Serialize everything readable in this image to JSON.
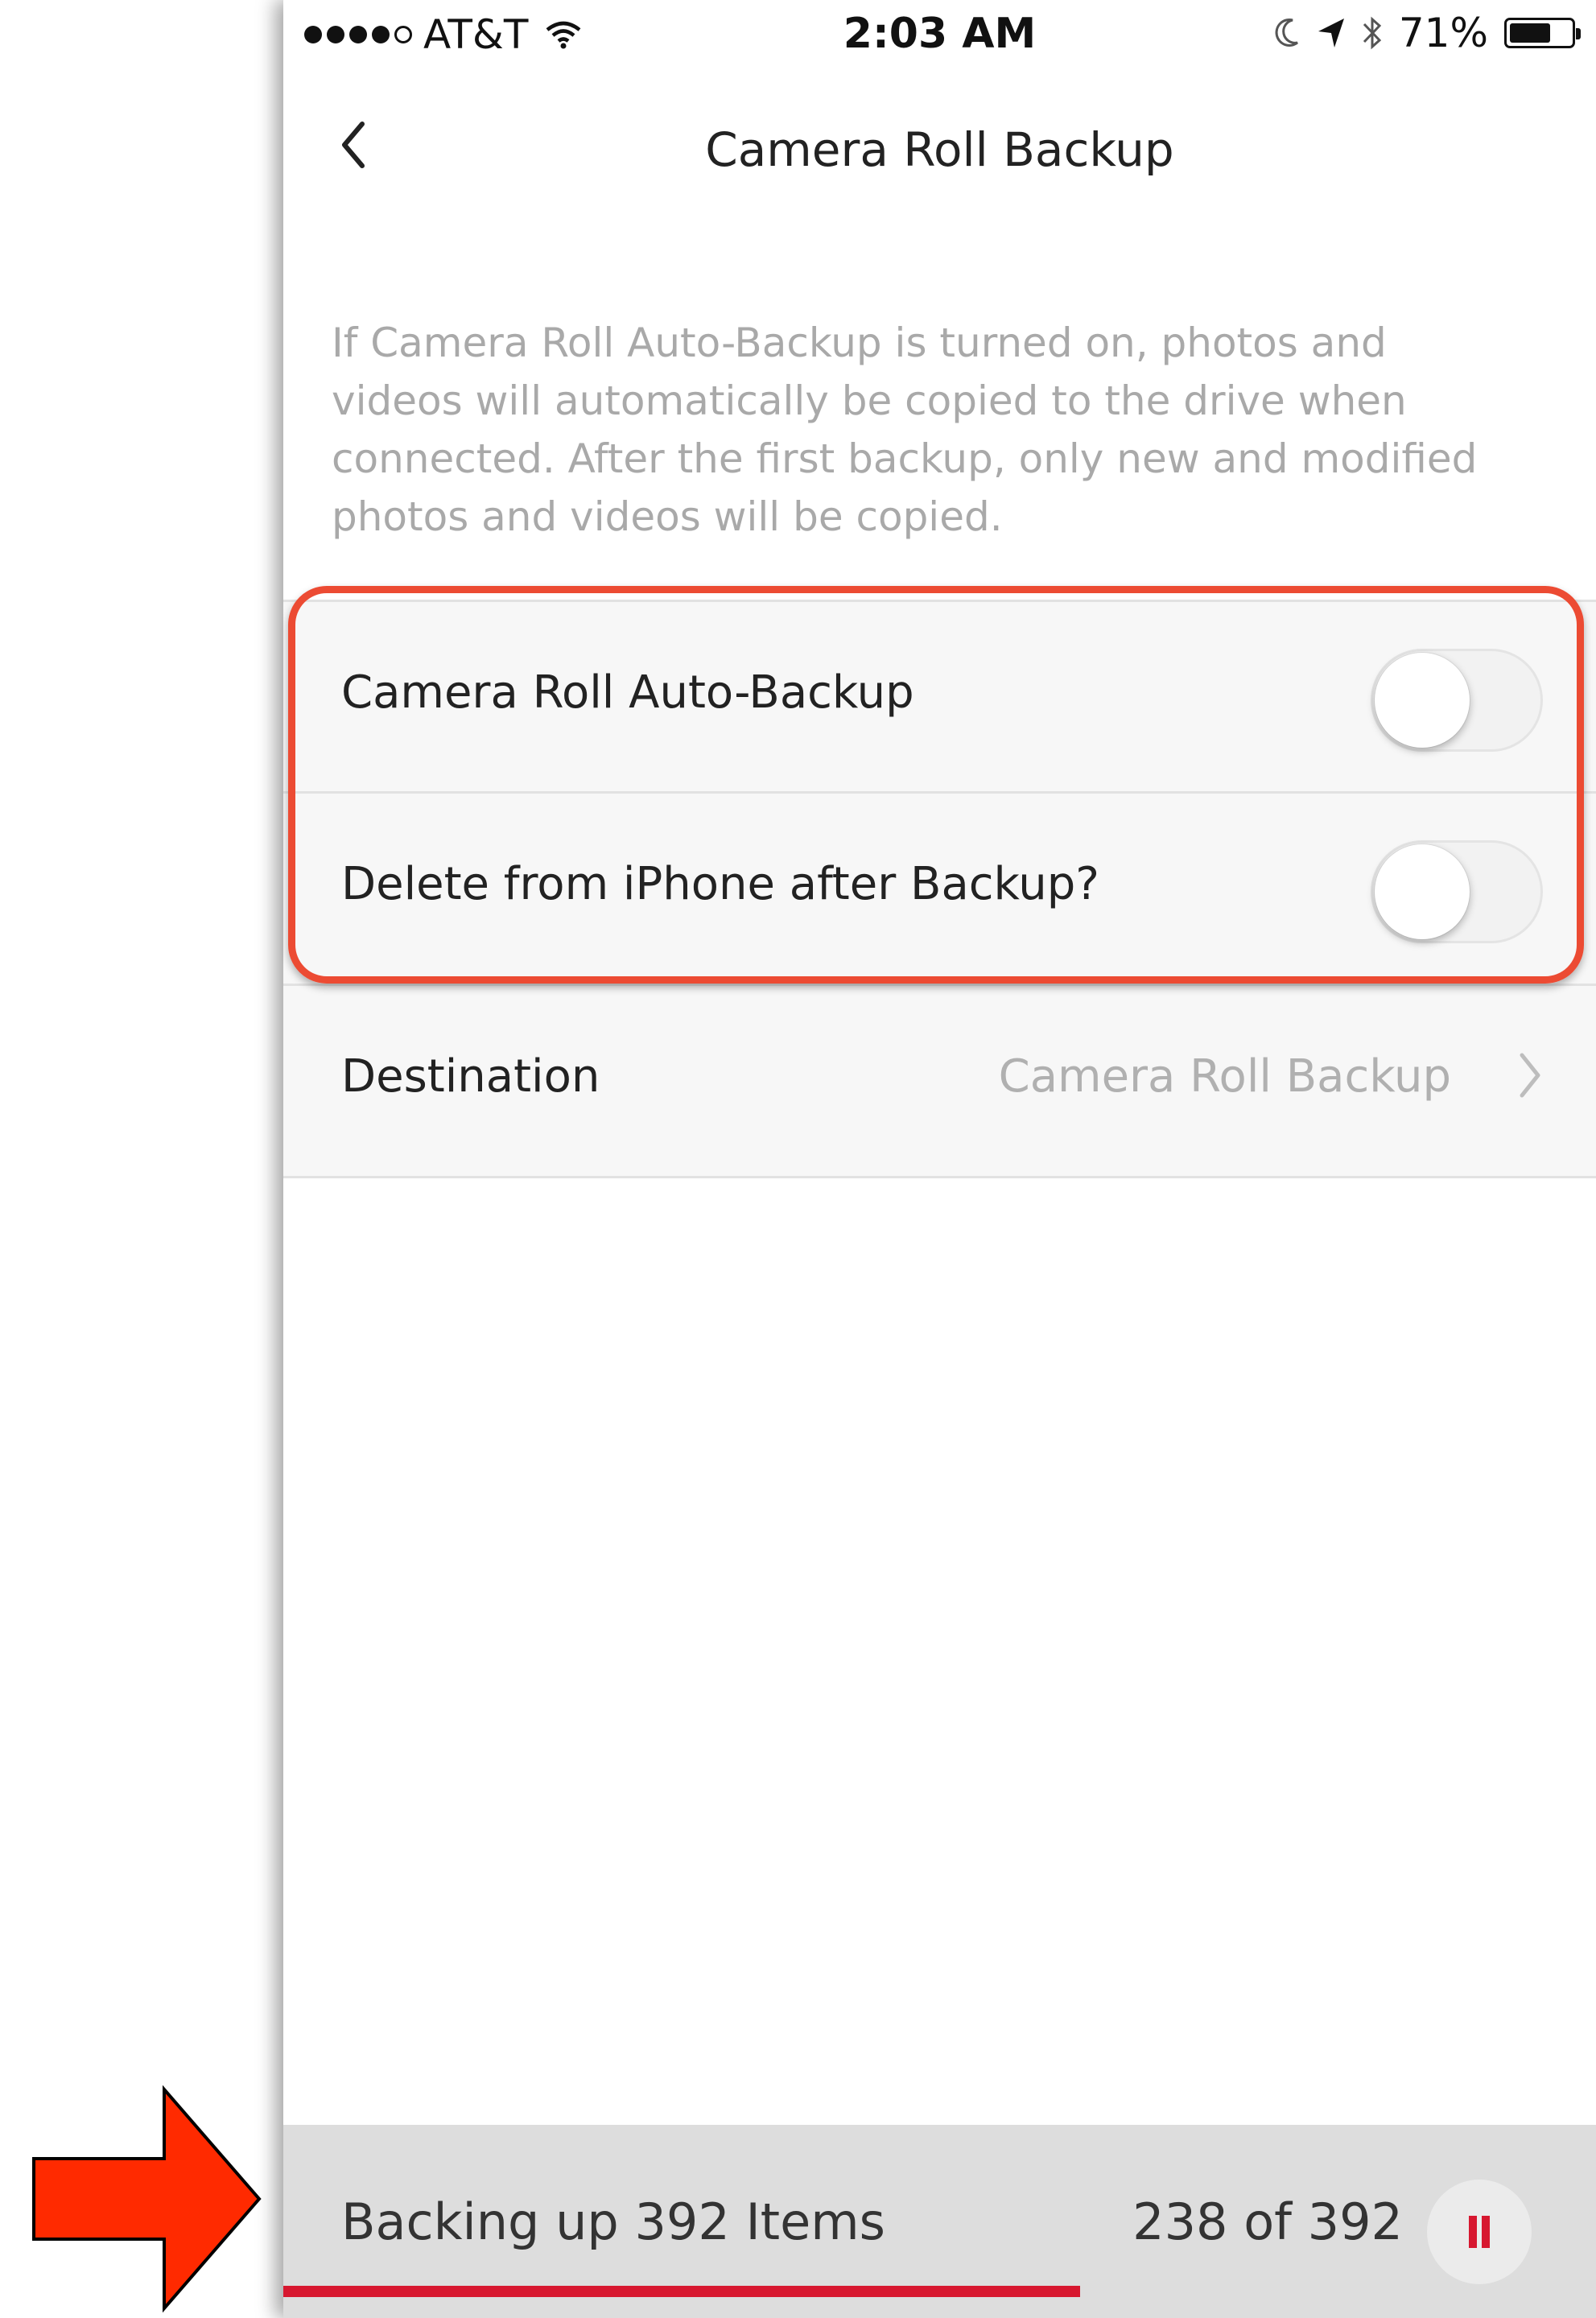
{
  "status_bar": {
    "carrier": "AT&T",
    "time": "2:03 AM",
    "battery": "71%",
    "battery_level": 0.71
  },
  "nav": {
    "title": "Camera Roll Backup",
    "back_icon": "chevron-left-icon"
  },
  "description": "If Camera Roll Auto-Backup is turned on, photos and videos will automatically be copied to the drive when connected. After the first backup, only new and modified photos and videos will be copied.",
  "settings": {
    "auto_backup": {
      "label": "Camera Roll Auto-Backup",
      "enabled": false
    },
    "delete_after": {
      "label": "Delete from iPhone after Backup?",
      "enabled": false
    },
    "destination": {
      "label": "Destination",
      "value": "Camera Roll Backup"
    }
  },
  "backup_status": {
    "label": "Backing up 392 Items",
    "count": "238 of 392",
    "done": 238,
    "total": 392
  },
  "colors": {
    "accent": "#d7172f",
    "highlight": "#ec4b33",
    "arrow": "#ff2a00"
  }
}
